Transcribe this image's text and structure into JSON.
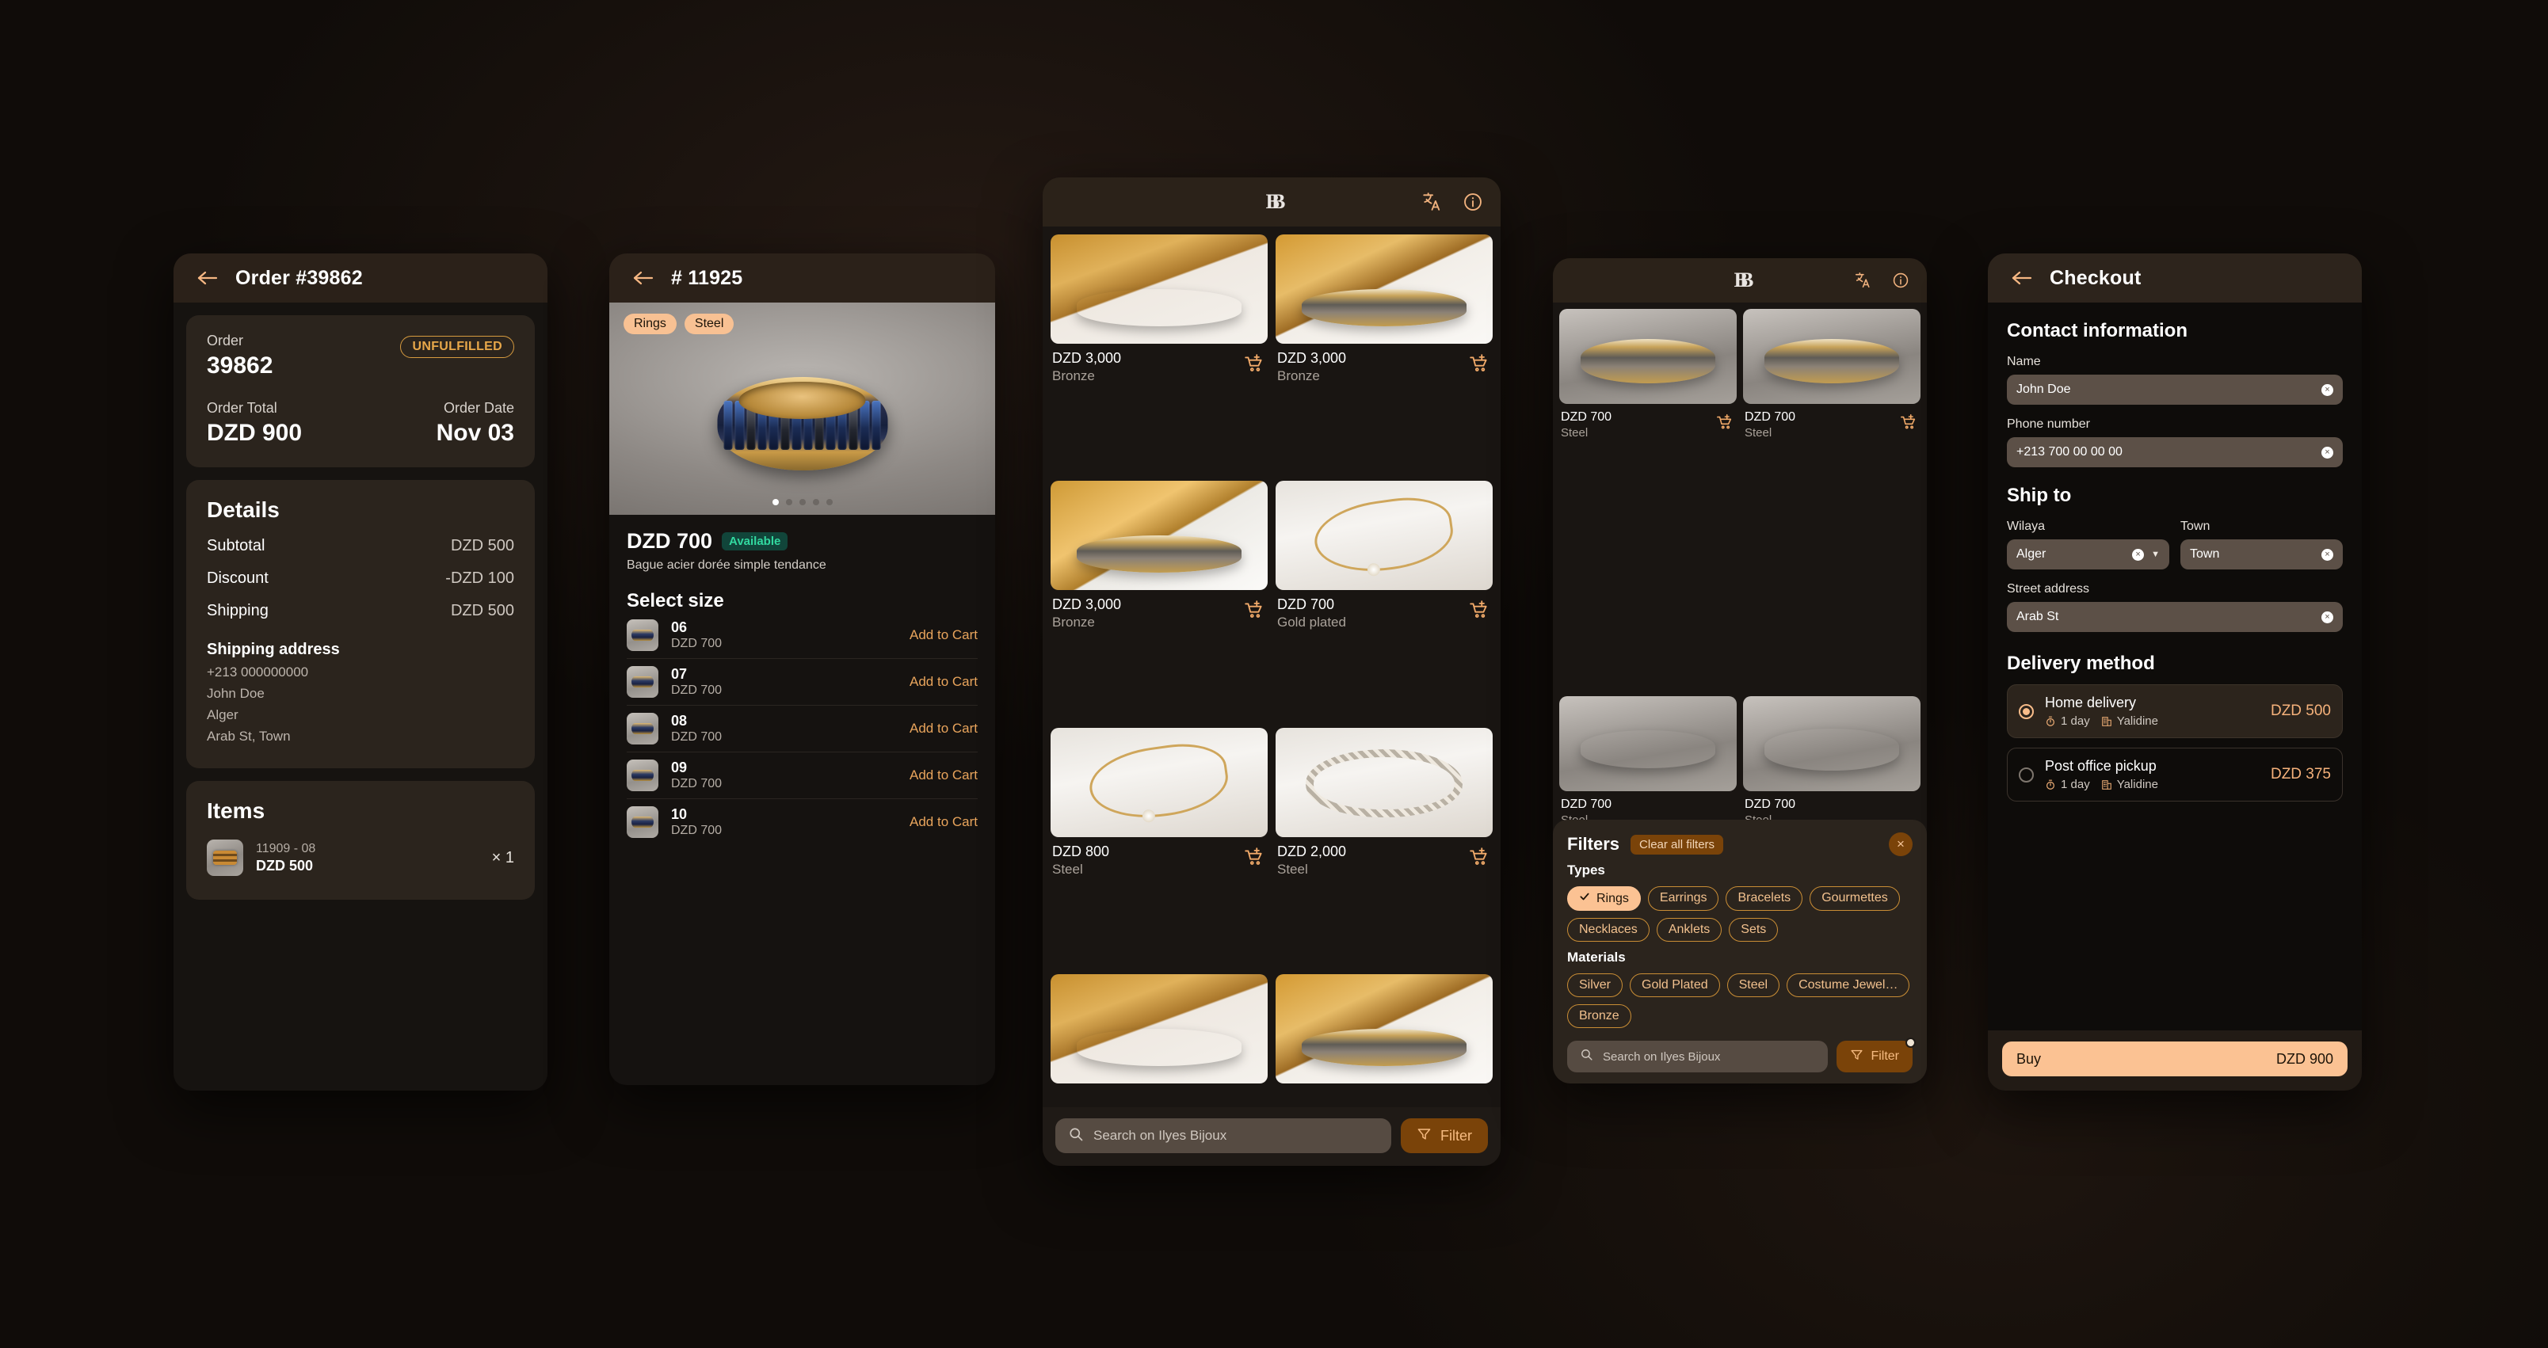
{
  "order_panel": {
    "title": "Order #39862",
    "summary": {
      "order_label": "Order",
      "order_number": "39862",
      "status_badge": "UNFULFILLED",
      "total_label": "Order Total",
      "total_value": "DZD 900",
      "date_label": "Order Date",
      "date_value": "Nov 03"
    },
    "details": {
      "heading": "Details",
      "lines": [
        {
          "label": "Subtotal",
          "value": "DZD 500"
        },
        {
          "label": "Discount",
          "value": "-DZD 100"
        },
        {
          "label": "Shipping",
          "value": "DZD 500"
        }
      ],
      "address_heading": "Shipping address",
      "address_lines": [
        "+213 000000000",
        "John Doe",
        "Alger",
        "Arab St, Town"
      ]
    },
    "items": {
      "heading": "Items",
      "rows": [
        {
          "sku": "11909 - 08",
          "price": "DZD 500",
          "qty": "× 1"
        }
      ]
    }
  },
  "product_panel": {
    "title": "# 11925",
    "chips": [
      "Rings",
      "Steel"
    ],
    "price": "DZD 700",
    "availability": "Available",
    "description": "Bague acier dorée simple tendance",
    "select_size_heading": "Select size",
    "sizes": [
      {
        "name": "06",
        "price": "DZD 700",
        "action": "Add to Cart"
      },
      {
        "name": "07",
        "price": "DZD 700",
        "action": "Add to Cart"
      },
      {
        "name": "08",
        "price": "DZD 700",
        "action": "Add to Cart"
      },
      {
        "name": "09",
        "price": "DZD 700",
        "action": "Add to Cart"
      },
      {
        "name": "10",
        "price": "DZD 700",
        "action": "Add to Cart"
      }
    ],
    "carousel_dots": 5,
    "carousel_active_index": 0
  },
  "catalog_panel": {
    "brand_mark": "BB",
    "products": [
      {
        "price": "DZD 3,000",
        "material": "Bronze"
      },
      {
        "price": "DZD 3,000",
        "material": "Bronze"
      },
      {
        "price": "DZD 3,000",
        "material": "Bronze"
      },
      {
        "price": "DZD 700",
        "material": "Gold plated"
      },
      {
        "price": "DZD 800",
        "material": "Steel"
      },
      {
        "price": "DZD 2,000",
        "material": "Steel"
      }
    ],
    "search_placeholder": "Search on Ilyes Bijoux",
    "filter_label": "Filter"
  },
  "filters_panel": {
    "brand_mark": "BB",
    "products": [
      {
        "price": "DZD 700",
        "material": "Steel"
      },
      {
        "price": "DZD 700",
        "material": "Steel"
      },
      {
        "price": "DZD 700",
        "material": "Steel"
      },
      {
        "price": "DZD 700",
        "material": "Steel"
      }
    ],
    "sheet": {
      "title": "Filters",
      "clear_label": "Clear all filters",
      "close_label": "×",
      "types_heading": "Types",
      "types": [
        {
          "label": "Rings",
          "selected": true
        },
        {
          "label": "Earrings",
          "selected": false
        },
        {
          "label": "Bracelets",
          "selected": false
        },
        {
          "label": "Gourmettes",
          "selected": false
        },
        {
          "label": "Necklaces",
          "selected": false
        },
        {
          "label": "Anklets",
          "selected": false
        },
        {
          "label": "Sets",
          "selected": false
        }
      ],
      "materials_heading": "Materials",
      "materials": [
        {
          "label": "Silver",
          "selected": false
        },
        {
          "label": "Gold Plated",
          "selected": false
        },
        {
          "label": "Steel",
          "selected": false
        },
        {
          "label": "Costume Jewel…",
          "selected": false
        },
        {
          "label": "Bronze",
          "selected": false
        }
      ],
      "search_placeholder": "Search on Ilyes Bijoux",
      "filter_label": "Filter"
    }
  },
  "checkout_panel": {
    "title": "Checkout",
    "contact_heading": "Contact information",
    "name_label": "Name",
    "name_value": "John Doe",
    "phone_label": "Phone number",
    "phone_value": "+213 700 00 00 00",
    "ship_heading": "Ship to",
    "wilaya_label": "Wilaya",
    "wilaya_value": "Alger",
    "town_label": "Town",
    "town_value": "Town",
    "street_label": "Street address",
    "street_value": "Arab St",
    "delivery_heading": "Delivery method",
    "delivery_options": [
      {
        "name": "Home delivery",
        "eta": "1 day",
        "carrier": "Yalidine",
        "price": "DZD 500",
        "selected": true
      },
      {
        "name": "Post office pickup",
        "eta": "1 day",
        "carrier": "Yalidine",
        "price": "DZD 375",
        "selected": false
      }
    ],
    "buy_label": "Buy",
    "buy_total": "DZD 900"
  },
  "colors": {
    "accent": "#fbc293",
    "accent_text": "#f2b37f",
    "panel": "#2b241d",
    "background": "#100c09",
    "status": "#e8a84a",
    "available": "#32d9a0"
  }
}
